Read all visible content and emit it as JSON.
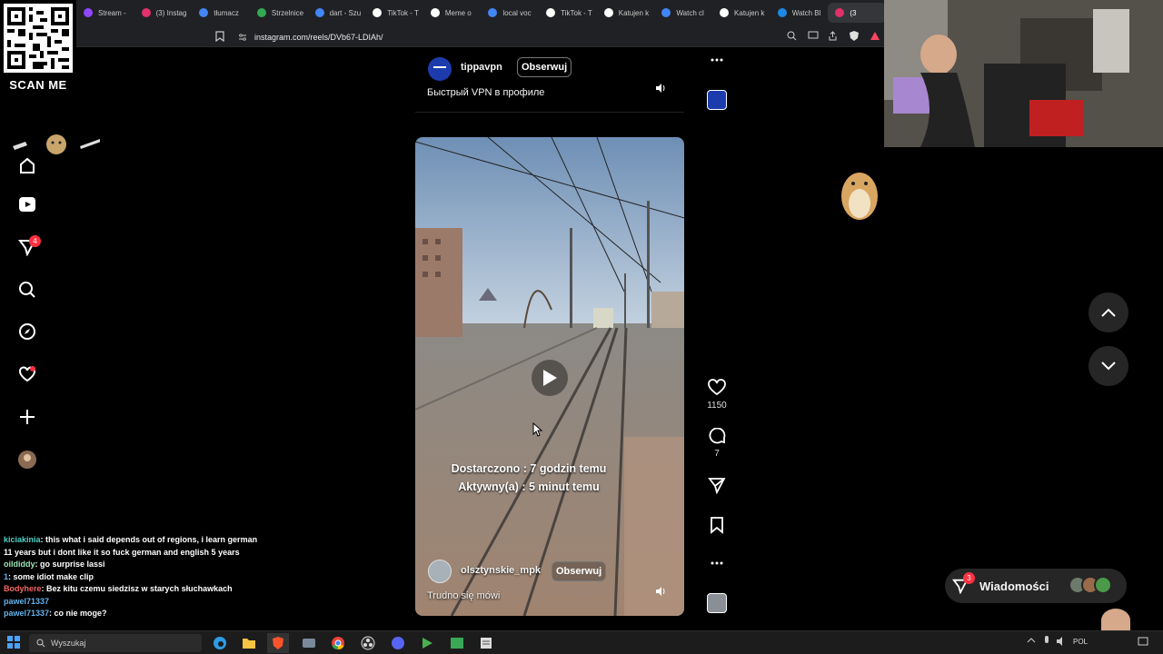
{
  "qr": {
    "label": "SCAN ME"
  },
  "browser": {
    "tabs": [
      {
        "title": "Stream -",
        "color": "#9146ff"
      },
      {
        "title": "(3) Instag",
        "color": "#e1306c"
      },
      {
        "title": "tłumacz",
        "color": "#4285f4"
      },
      {
        "title": "Strzelnice",
        "color": "#34a853"
      },
      {
        "title": "dart - Szu",
        "color": "#4285f4"
      },
      {
        "title": "TikTok - T",
        "color": "#ffffff"
      },
      {
        "title": "Meme o",
        "color": "#ffffff"
      },
      {
        "title": "local voc",
        "color": "#4285f4"
      },
      {
        "title": "TikTok - T",
        "color": "#ffffff"
      },
      {
        "title": "Katujen k",
        "color": "#ffffff"
      },
      {
        "title": "Watch cl",
        "color": "#4285f4"
      },
      {
        "title": "Katujen k",
        "color": "#ffffff"
      },
      {
        "title": "Watch Bl",
        "color": "#1e88e5"
      },
      {
        "title": "(3",
        "color": "#e1306c"
      }
    ],
    "url": "instagram.com/reels/DVb67-LDIAh/"
  },
  "sidebar": {
    "notifications_badge": "4"
  },
  "top_reel": {
    "username": "tippavpn",
    "follow_label": "Obserwuj",
    "caption": "Быстрый VPN в профиле"
  },
  "reel": {
    "overlay_line1": "Dostarczono : 7 godzin temu",
    "overlay_line2": "Aktywny(a) : 5 minut temu",
    "username": "olsztynskie_mpk",
    "follow_label": "Obserwuj",
    "caption": "Trudno się mówi",
    "likes": "1150",
    "comments": "7"
  },
  "messages": {
    "label": "Wiadomości",
    "badge": "3"
  },
  "chat": [
    {
      "user": "kiciakinia",
      "text": "this what i said depends out of regions, i learn german 11 years but i dont like it so fuck german and english 5 years",
      "cls": "user1"
    },
    {
      "user": "oildiddy",
      "text": "go surprise lassi",
      "cls": "user2"
    },
    {
      "user": "1",
      "text": "some idiot make clip",
      "cls": "user4"
    },
    {
      "user": "Bodyhere",
      "text": "Bez kitu czemu siedzisz w starych słuchawkach",
      "cls": "user3"
    },
    {
      "user": "pawel71337",
      "text": "",
      "cls": "user4"
    },
    {
      "user": "pawel71337",
      "text": "co nie moge?",
      "cls": "user4"
    }
  ],
  "taskbar": {
    "search_placeholder": "Wyszukaj",
    "lang": "POL"
  }
}
